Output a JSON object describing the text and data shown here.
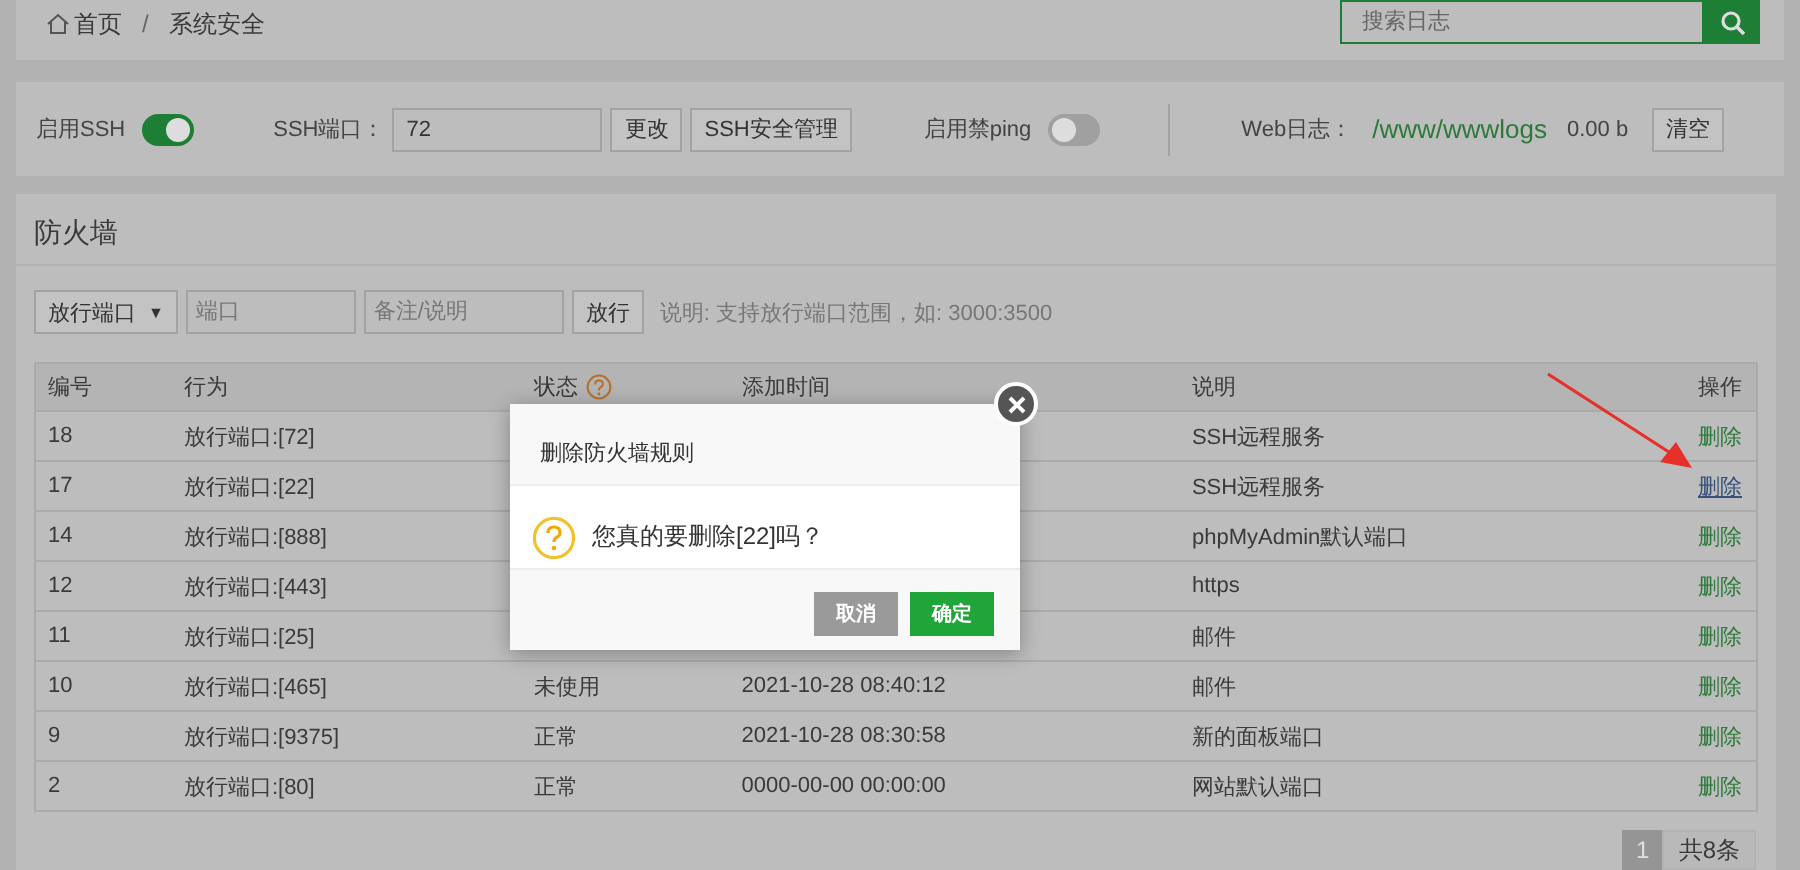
{
  "breadcrumb": {
    "items": [
      "首页",
      "系统安全"
    ],
    "separator": "/"
  },
  "search": {
    "placeholder": "搜索日志"
  },
  "settings": {
    "ssh": {
      "label": "启用SSH",
      "on": true
    },
    "ssh_port": {
      "label": "SSH端口：",
      "value": "72",
      "buttons": [
        "更改",
        "SSH安全管理"
      ]
    },
    "ping": {
      "label": "启用禁ping",
      "on": false
    },
    "web_log": {
      "label": "Web日志：",
      "path": "/www/wwwlogs",
      "size": "0.00 b",
      "button": "清空"
    }
  },
  "firewall": {
    "title": "防火墙",
    "select": {
      "value": "放行端口",
      "caret": "▼"
    },
    "port_field": {
      "placeholder": "端口"
    },
    "note_field": {
      "placeholder": "备注/说明"
    },
    "add_button": "放行",
    "hint": "说明: 支持放行端口范围，如: 3000:3500",
    "table": {
      "columns": [
        "编号",
        "行为",
        "状态",
        "添加时间",
        "说明",
        "操作"
      ],
      "rows": [
        {
          "id": "18",
          "action": "放行端口:[72]",
          "description": "SSH远程服务",
          "operation": "删除",
          "hovered": false
        },
        {
          "id": "17",
          "action": "放行端口:[22]",
          "description": "SSH远程服务",
          "operation": "删除",
          "hovered": true
        },
        {
          "id": "14",
          "action": "放行端口:[888]",
          "description": "phpMyAdmin默认端口",
          "operation": "删除",
          "hovered": false
        },
        {
          "id": "12",
          "action": "放行端口:[443]",
          "description": "https",
          "operation": "删除",
          "hovered": false
        },
        {
          "id": "11",
          "action": "放行端口:[25]",
          "description": "邮件",
          "operation": "删除",
          "hovered": false
        },
        {
          "id": "10",
          "action": "放行端口:[465]",
          "status": "未使用",
          "time": "2021-10-28 08:40:12",
          "description": "邮件",
          "operation": "删除",
          "hovered": false
        },
        {
          "id": "9",
          "action": "放行端口:[9375]",
          "status": "正常",
          "time": "2021-10-28 08:30:58",
          "description": "新的面板端口",
          "operation": "删除",
          "hovered": false
        },
        {
          "id": "2",
          "action": "放行端口:[80]",
          "status": "正常",
          "time": "0000-00-00 00:00:00",
          "description": "网站默认端口",
          "operation": "删除",
          "hovered": false
        }
      ]
    },
    "pagination": {
      "pages": [
        {
          "label": "1",
          "selected": true
        }
      ],
      "total": "共8条"
    }
  },
  "dialog": {
    "title": "删除防火墙规则",
    "message": "您真的要删除[22]吗？",
    "buttons": [
      {
        "label": "取消",
        "kind": "cancel"
      },
      {
        "label": "确定",
        "kind": "confirm"
      }
    ]
  }
}
